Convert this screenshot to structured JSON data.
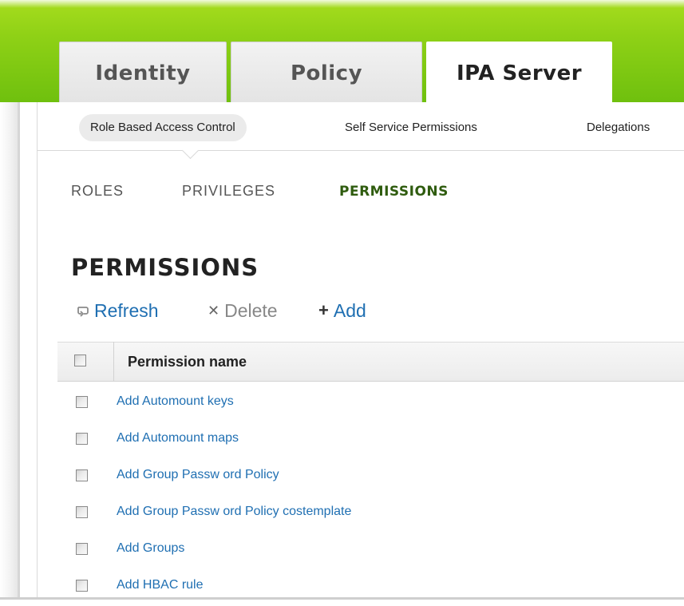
{
  "main_tabs": [
    {
      "label": "Identity",
      "active": false
    },
    {
      "label": "Policy",
      "active": false
    },
    {
      "label": "IPA Server",
      "active": true
    }
  ],
  "sub_nav": [
    {
      "label": "Role Based Access Control",
      "active": true
    },
    {
      "label": "Self Service Permissions",
      "active": false
    },
    {
      "label": "Delegations",
      "active": false
    }
  ],
  "third_nav": [
    {
      "label": "ROLES",
      "active": false
    },
    {
      "label": "PRIVILEGES",
      "active": false
    },
    {
      "label": "PERMISSIONS",
      "active": true
    }
  ],
  "page": {
    "title": "PERMISSIONS"
  },
  "actions": {
    "refresh_label": "Refresh",
    "refresh_icon": "refresh-icon",
    "delete_label": "Delete",
    "delete_icon": "delete-icon",
    "add_label": "Add",
    "add_icon": "add-icon"
  },
  "table": {
    "column_header": "Permission name",
    "rows": [
      "Add Automount keys",
      "Add Automount maps",
      "Add Group Passw ord Policy",
      "Add Group Passw ord Policy costemplate",
      "Add Groups",
      "Add HBAC rule"
    ]
  },
  "colors": {
    "header_green": "#8fd116",
    "active_nav_green": "#2f5c0f",
    "link_blue": "#1f6fb2"
  }
}
